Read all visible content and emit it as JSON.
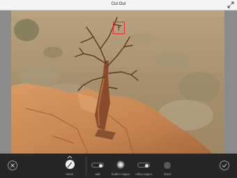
{
  "window": {
    "title": "Cut Out",
    "expand_icon": "expand-arrows-icon"
  },
  "toolbar": {
    "cancel_icon": "close-icon",
    "confirm_icon": "checkmark-icon",
    "tools": [
      {
        "label": "smart",
        "icon": "brush-icon",
        "selected": true
      },
      {
        "label": "add",
        "icon": "toggle-icon"
      },
      {
        "label": "feather edges",
        "icon": "soft-dot-icon"
      },
      {
        "label": "refine edges",
        "icon": "toggle-icon"
      },
      {
        "label": "invert",
        "icon": "invert-circle-icon"
      }
    ]
  },
  "colors": {
    "selection": "#d9322e",
    "toolbar_bg": "#262626",
    "canvas_bg": "#8b8b8b"
  }
}
